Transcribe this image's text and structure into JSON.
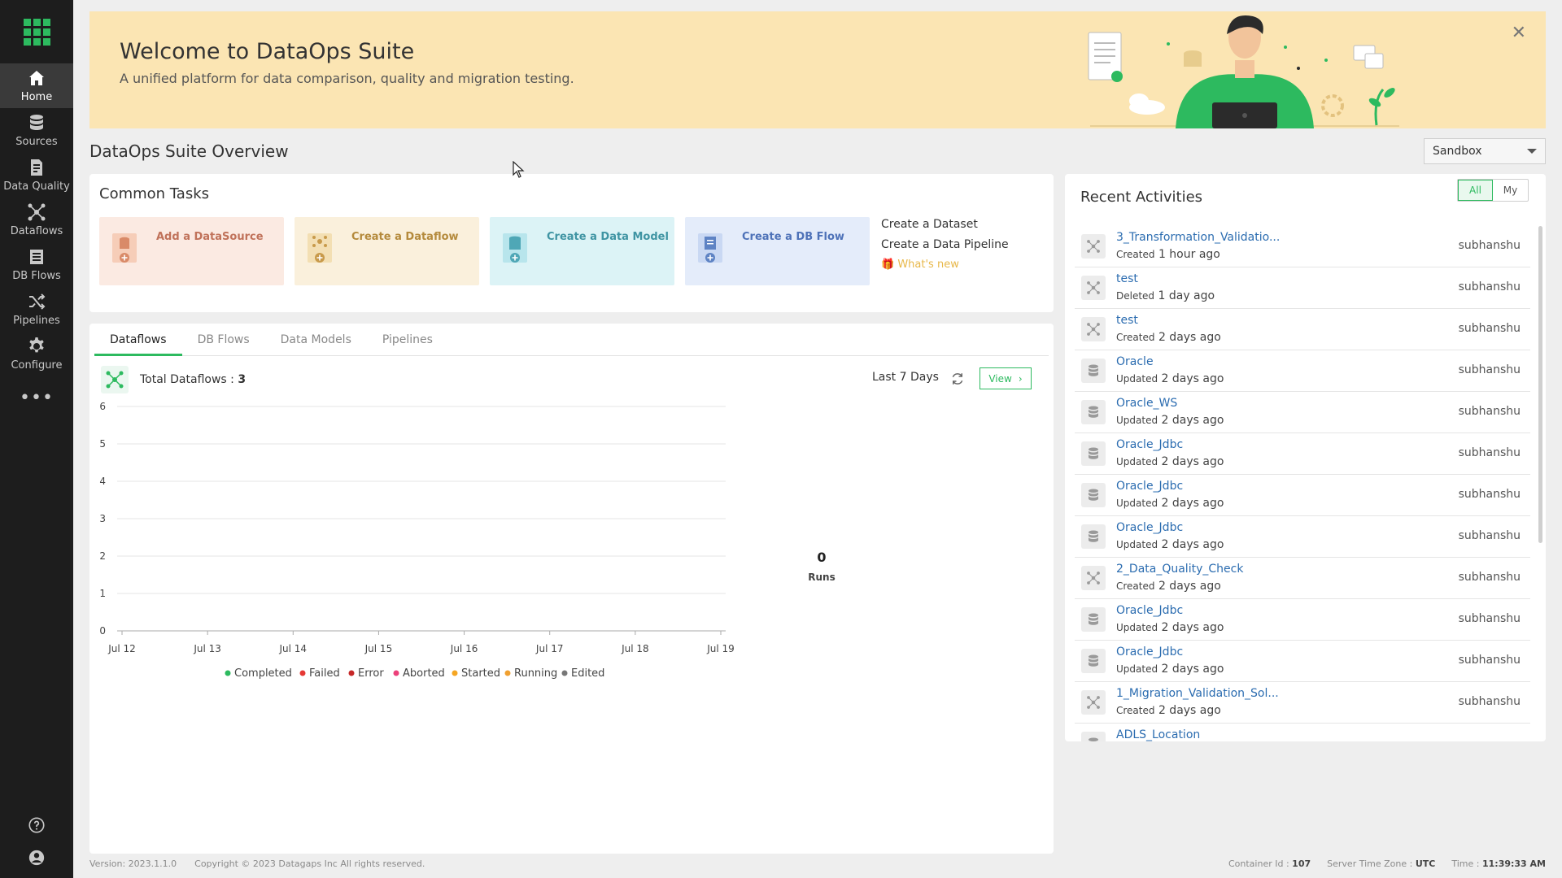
{
  "sidebar": {
    "items": [
      {
        "label": "Home",
        "icon": "home-icon",
        "active": true
      },
      {
        "label": "Sources",
        "icon": "database-icon"
      },
      {
        "label": "Data Quality",
        "icon": "document-check-icon"
      },
      {
        "label": "Dataflows",
        "icon": "network-icon"
      },
      {
        "label": "DB Flows",
        "icon": "db-flow-icon"
      },
      {
        "label": "Pipelines",
        "icon": "shuffle-icon"
      },
      {
        "label": "Configure",
        "icon": "gear-icon"
      }
    ],
    "more": "•••"
  },
  "banner": {
    "title": "Welcome to DataOps Suite",
    "subtitle": "A unified platform for data comparison, quality and migration testing.",
    "close": "✕"
  },
  "overview": {
    "title": "DataOps Suite Overview",
    "environment": "Sandbox"
  },
  "tasks": {
    "title": "Common Tasks",
    "tiles": [
      {
        "label": "Add a DataSource"
      },
      {
        "label": "Create a Dataflow"
      },
      {
        "label": "Create a Data Model"
      },
      {
        "label": "Create a DB Flow"
      }
    ],
    "links": {
      "dataset": "Create a Dataset",
      "pipeline": "Create a Data Pipeline",
      "whats_new": "What's new"
    }
  },
  "flows": {
    "tabs": [
      "Dataflows",
      "DB Flows",
      "Data Models",
      "Pipelines"
    ],
    "total_label": "Total Dataflows : ",
    "total_value": "3",
    "range": "Last 7 Days",
    "view_label": "View",
    "runs_value": "0",
    "runs_label": "Runs"
  },
  "chart_data": {
    "type": "line",
    "categories": [
      "Jul 12",
      "Jul 13",
      "Jul 14",
      "Jul 15",
      "Jul 16",
      "Jul 17",
      "Jul 18",
      "Jul 19"
    ],
    "yticks": [
      "0",
      "1",
      "2",
      "3",
      "4",
      "5",
      "6"
    ],
    "ylim": [
      0,
      6
    ],
    "grid": true,
    "legend_position": "bottom",
    "series": [
      {
        "name": "Completed",
        "color": "#2dba5f",
        "values": []
      },
      {
        "name": "Failed",
        "color": "#e53935",
        "values": []
      },
      {
        "name": "Error",
        "color": "#c62828",
        "values": []
      },
      {
        "name": "Aborted",
        "color": "#ec407a",
        "values": []
      },
      {
        "name": "Started",
        "color": "#f5a623",
        "values": []
      },
      {
        "name": "Running",
        "color": "#f0a030",
        "values": []
      },
      {
        "name": "Edited",
        "color": "#777777",
        "values": []
      }
    ]
  },
  "recent": {
    "title": "Recent Activities",
    "toggle": [
      "All",
      "My"
    ],
    "items": [
      {
        "name": "3_Transformation_Validatio...",
        "action": "Created",
        "time": "1 hour ago",
        "user": "subhanshu",
        "icon": "dataflow-icon"
      },
      {
        "name": "test",
        "action": "Deleted",
        "time": "1 day ago",
        "user": "subhanshu",
        "icon": "dataflow-icon"
      },
      {
        "name": "test",
        "action": "Created",
        "time": "2 days ago",
        "user": "subhanshu",
        "icon": "dataflow-icon"
      },
      {
        "name": "Oracle",
        "action": "Updated",
        "time": "2 days ago",
        "user": "subhanshu",
        "icon": "database-icon"
      },
      {
        "name": "Oracle_WS",
        "action": "Updated",
        "time": "2 days ago",
        "user": "subhanshu",
        "icon": "database-icon"
      },
      {
        "name": "Oracle_Jdbc",
        "action": "Updated",
        "time": "2 days ago",
        "user": "subhanshu",
        "icon": "database-icon"
      },
      {
        "name": "Oracle_Jdbc",
        "action": "Updated",
        "time": "2 days ago",
        "user": "subhanshu",
        "icon": "database-icon"
      },
      {
        "name": "Oracle_Jdbc",
        "action": "Updated",
        "time": "2 days ago",
        "user": "subhanshu",
        "icon": "database-icon"
      },
      {
        "name": "2_Data_Quality_Check",
        "action": "Created",
        "time": "2 days ago",
        "user": "subhanshu",
        "icon": "dataflow-icon"
      },
      {
        "name": "Oracle_Jdbc",
        "action": "Updated",
        "time": "2 days ago",
        "user": "subhanshu",
        "icon": "database-icon"
      },
      {
        "name": "Oracle_Jdbc",
        "action": "Updated",
        "time": "2 days ago",
        "user": "subhanshu",
        "icon": "database-icon"
      },
      {
        "name": "1_Migration_Validation_Sol...",
        "action": "Created",
        "time": "2 days ago",
        "user": "subhanshu",
        "icon": "dataflow-icon"
      },
      {
        "name": "ADLS_Location",
        "action": "",
        "time": "",
        "user": "",
        "icon": "database-icon"
      }
    ]
  },
  "footer": {
    "version": "Version: 2023.1.1.0",
    "copyright": "Copyright © 2023 Datagaps Inc All rights reserved.",
    "container_label": "Container Id : ",
    "container_value": "107",
    "tz_label": "Server Time Zone : ",
    "tz_value": "UTC",
    "time_label": "Time : ",
    "time_value": "11:39:33 AM"
  },
  "colors": {
    "accent": "#2dba5f",
    "sidebar": "#1d1d1d",
    "banner": "#fbe5b3",
    "link": "#2b6cb0"
  }
}
